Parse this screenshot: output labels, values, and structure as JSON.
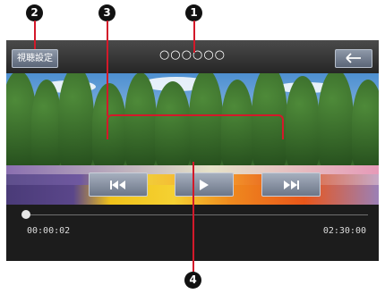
{
  "callouts": [
    "1",
    "2",
    "3",
    "4"
  ],
  "header": {
    "settings_label": "視聴設定",
    "title": "○○○○○○",
    "back_icon": "back-arrow-icon"
  },
  "controls": {
    "prev_icon": "skip-previous-icon",
    "play_icon": "play-icon",
    "next_icon": "skip-next-icon"
  },
  "playback": {
    "current_time": "00:00:02",
    "total_time": "02:30:00",
    "progress": 0.0002
  },
  "colors": {
    "callout_line": "#d3192a",
    "button": "#8e98a8",
    "bar": "#2b2b2b"
  }
}
